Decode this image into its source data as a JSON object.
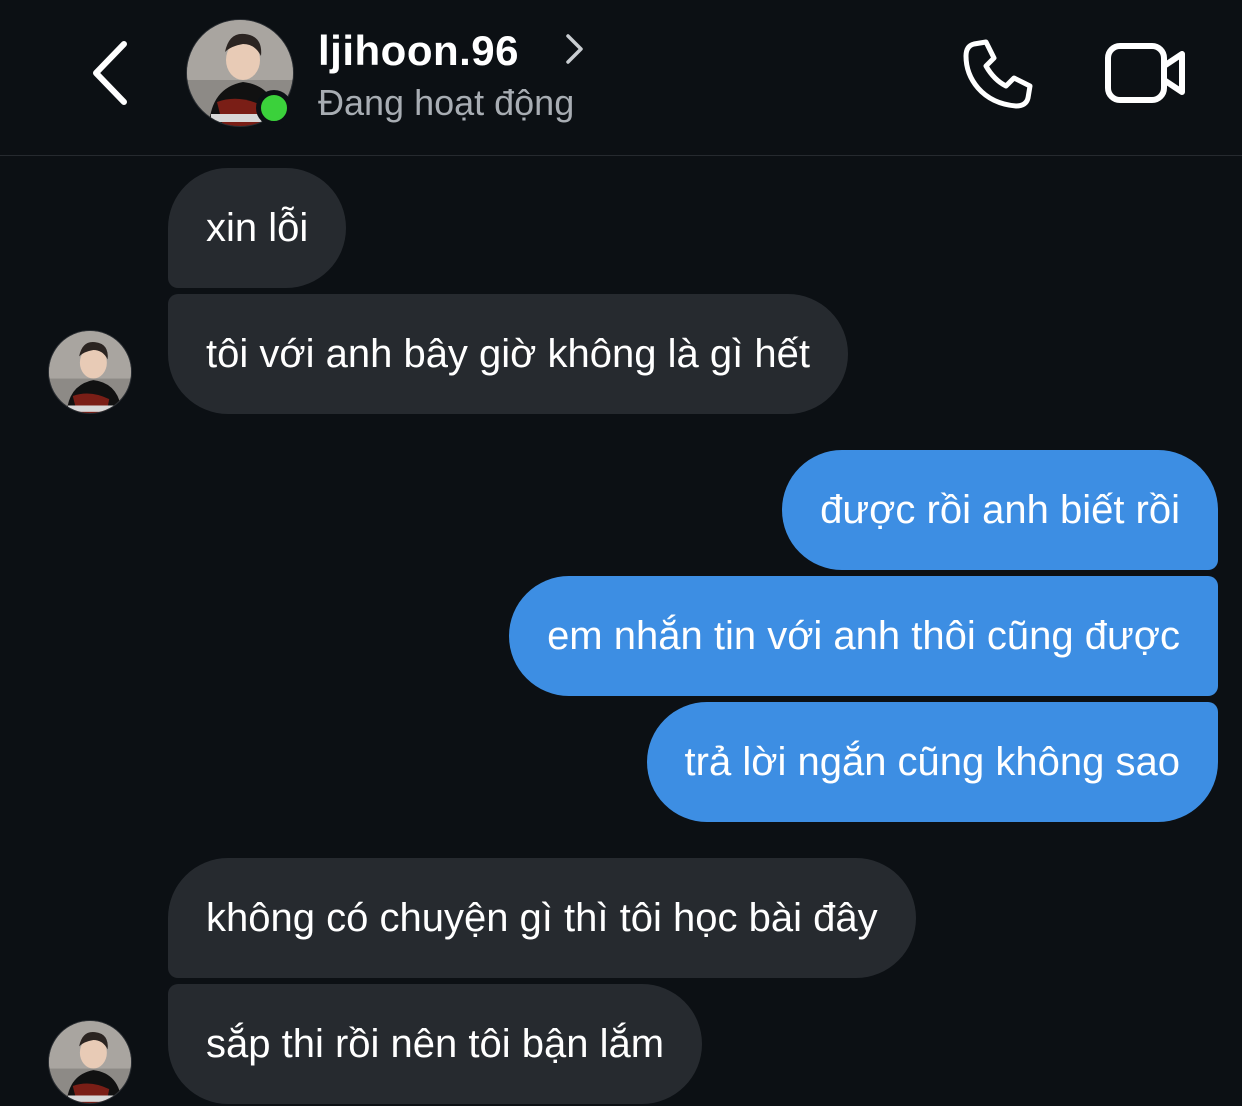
{
  "header": {
    "username": "ljihoon.96",
    "status": "Đang hoạt động",
    "back_icon": "chevron-left-icon",
    "call_icon": "phone-icon",
    "video_icon": "video-camera-icon",
    "online_color": "#3bd13b"
  },
  "messages": [
    {
      "direction": "incoming",
      "text": "xin lỗi"
    },
    {
      "direction": "incoming",
      "text": "tôi với anh bây giờ không là gì hết"
    },
    {
      "direction": "outgoing",
      "text": "được rồi anh biết rồi"
    },
    {
      "direction": "outgoing",
      "text": "em nhắn tin với anh thôi cũng được"
    },
    {
      "direction": "outgoing",
      "text": "trả lời ngắn cũng không sao"
    },
    {
      "direction": "incoming",
      "text": "không có chuyện gì thì tôi học bài đây"
    },
    {
      "direction": "incoming",
      "text": "sắp thi rồi nên tôi bận lắm"
    }
  ],
  "colors": {
    "background": "#0c1014",
    "incoming_bubble": "#262a2f",
    "outgoing_bubble": "#3d8ee3"
  }
}
